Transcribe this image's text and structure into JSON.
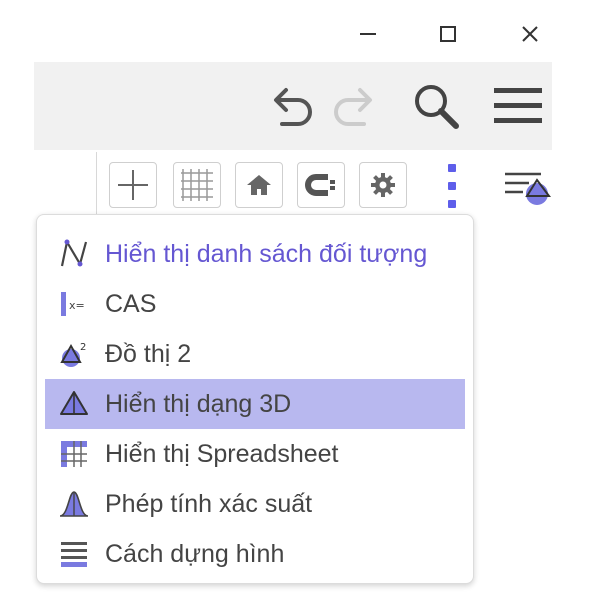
{
  "window_controls": {
    "minimize_icon": "minimize-icon",
    "maximize_icon": "maximize-icon",
    "close_icon": "close-icon"
  },
  "header": {
    "buttons": [
      "undo-icon",
      "redo-icon",
      "search-icon",
      "hamburger-menu-icon"
    ]
  },
  "style_bar": {
    "buttons": [
      "axes-icon",
      "grid-icon",
      "home-icon",
      "capture-icon",
      "gear-icon",
      "more-vertical-icon",
      "view-style-icon"
    ],
    "accent_color": "#5e5eea"
  },
  "menu": {
    "items": [
      {
        "label": "Hiển thị danh sách đối tượng",
        "icon": "algebra-icon",
        "accent": true
      },
      {
        "label": "CAS",
        "icon": "cas-icon"
      },
      {
        "label": "Đồ thị 2",
        "icon": "graphics2-icon"
      },
      {
        "label": "Hiển thị dạng 3D",
        "icon": "graphics3d-icon",
        "selected": true
      },
      {
        "label": "Hiển thị Spreadsheet",
        "icon": "spreadsheet-icon"
      },
      {
        "label": "Phép tính xác suất",
        "icon": "probability-icon"
      },
      {
        "label": "Cách dựng hình",
        "icon": "construction-protocol-icon"
      }
    ],
    "selected_color": "#b8b8ef",
    "accent_color": "#6557d2"
  }
}
